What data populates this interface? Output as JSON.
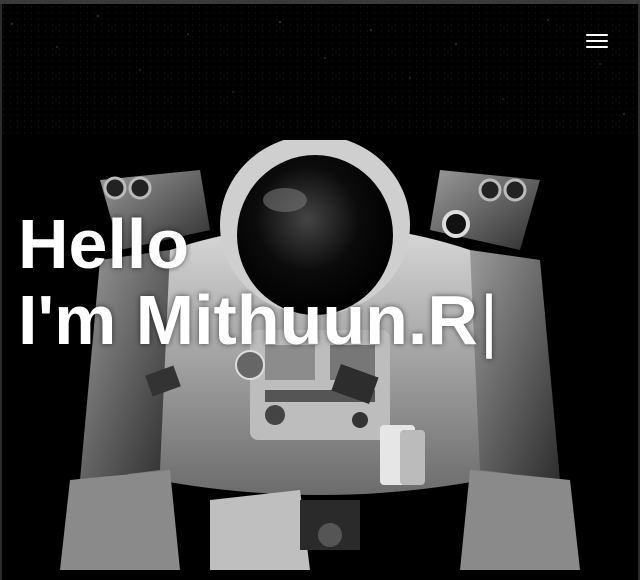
{
  "nav": {
    "menu_icon": "hamburger-menu-icon"
  },
  "hero": {
    "line1": "Hello",
    "line2": "I'm Mithuun.R",
    "cursor": "|"
  },
  "colors": {
    "background": "#000000",
    "text": "#ffffff"
  }
}
